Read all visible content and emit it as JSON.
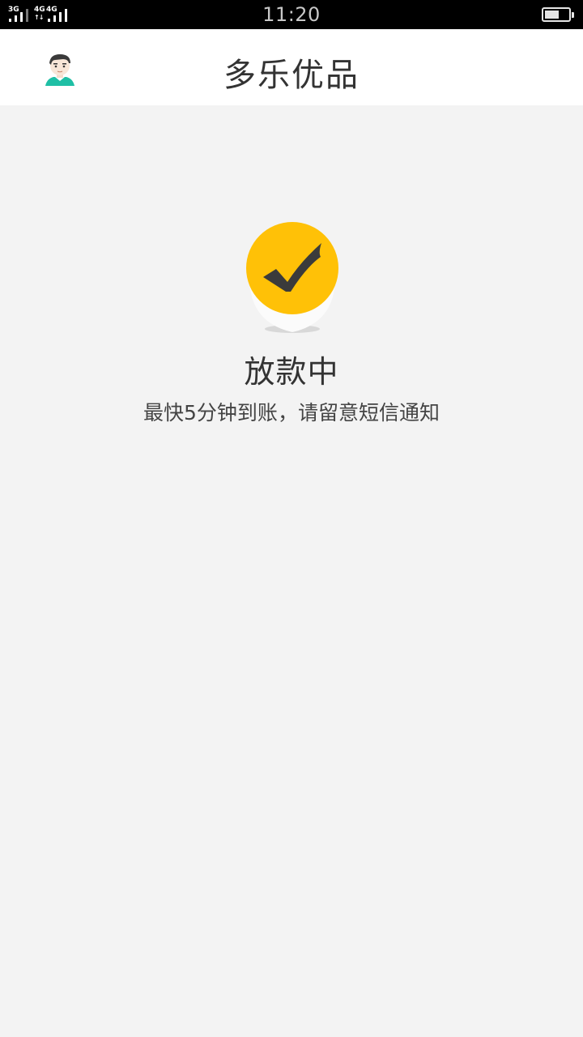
{
  "status_bar": {
    "sim1_network": "3G",
    "sim2_network_a": "4G",
    "sim2_network_b": "4G",
    "time": "11:20",
    "battery_icon": "battery-icon"
  },
  "header": {
    "title": "多乐优品",
    "avatar_icon": "user-avatar-icon"
  },
  "result": {
    "icon": "check-circle-icon",
    "accent_color": "#ffc107",
    "title": "放款中",
    "subtitle": "最快5分钟到账，请留意短信通知"
  }
}
